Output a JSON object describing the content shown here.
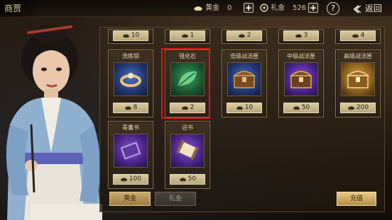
{
  "header": {
    "title": "商贾",
    "gold_label": "黄金",
    "gold_value": "0",
    "gift_label": "礼金",
    "gift_value": "526",
    "help_label": "?",
    "back_label": "返回"
  },
  "shop": {
    "top_row_prices": [
      "10",
      "1",
      "2",
      "3",
      "4"
    ],
    "items": [
      {
        "name": "洗练钼",
        "price": "8",
        "icon": "ring-icon"
      },
      {
        "name": "强化石",
        "price": "2",
        "icon": "leaf-stone-icon"
      },
      {
        "name": "低级战法匣",
        "price": "10",
        "icon": "chest-blue-icon"
      },
      {
        "name": "中级战法匣",
        "price": "50",
        "icon": "chest-purple-icon"
      },
      {
        "name": "高级战法匣",
        "price": "200",
        "icon": "chest-gold-icon"
      },
      {
        "name": "青囊书",
        "price": "100",
        "icon": "book-icon"
      },
      {
        "name": "诏书",
        "price": "50",
        "icon": "scroll-icon"
      }
    ],
    "highlight_item": "强化石"
  },
  "footer": {
    "tab_gold": "黄金",
    "tab_gift": "礼金",
    "recharge": "充值"
  },
  "colors": {
    "highlight": "#e01414",
    "card_border": "#8d7448",
    "price_bar": "#d8caa0"
  }
}
